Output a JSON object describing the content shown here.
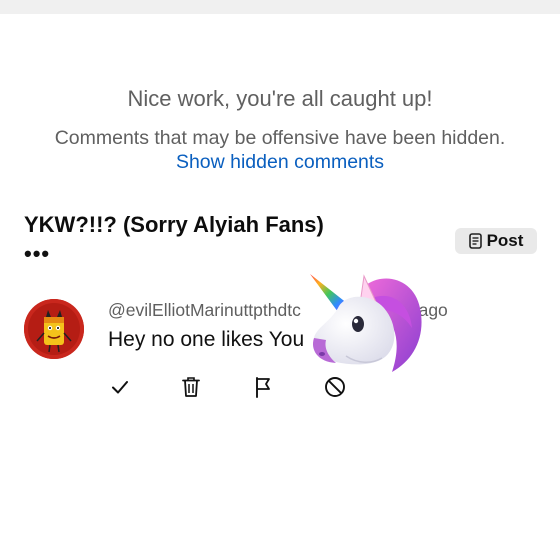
{
  "header": {
    "caught_up": "Nice work, you're all caught up!",
    "hidden_note": "Comments that may be offensive have been hidden.",
    "show_hidden_link": "Show hidden comments"
  },
  "post": {
    "title": "YKW?!!? (Sorry Alyiah Fans)",
    "more": "•••",
    "post_button_label": "Post"
  },
  "comment": {
    "handle": "@evilElliotMarinuttpthdtc",
    "time": "h ago",
    "text": "Hey no one likes You"
  },
  "actions": [
    {
      "icon": "check-icon"
    },
    {
      "icon": "trash-icon"
    },
    {
      "icon": "flag-icon"
    },
    {
      "icon": "block-icon"
    }
  ],
  "colors": {
    "link": "#0a5fbf",
    "muted_text": "#606060",
    "avatar_bg": "#c9271d",
    "post_button_bg": "#e9e9e9"
  }
}
